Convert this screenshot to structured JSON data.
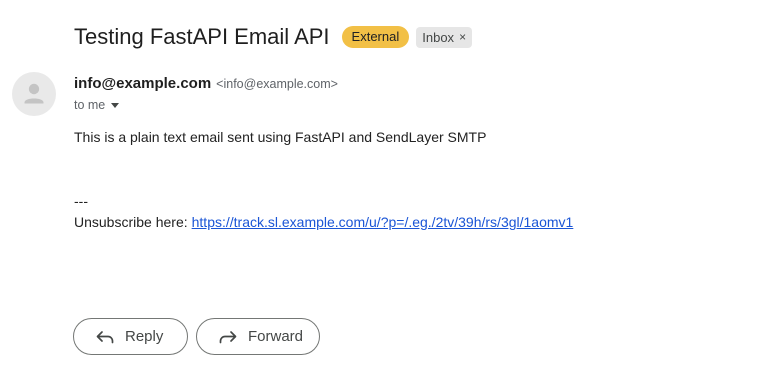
{
  "subject": "Testing FastAPI Email API",
  "labels": {
    "external": "External",
    "inbox": "Inbox",
    "inbox_remove": "×"
  },
  "sender": {
    "name": "info@example.com",
    "email": "<info@example.com>",
    "to": "to me"
  },
  "body": {
    "text": "This is a plain text email sent using FastAPI and SendLayer SMTP",
    "signature_dash": "---",
    "unsubscribe_prefix": "Unsubscribe here:",
    "unsubscribe_link": "https://track.sl.example.com/u/?p=/.eg./2tv/39h/rs/3gl/1aomv1"
  },
  "actions": {
    "reply": "Reply",
    "forward": "Forward"
  },
  "icons": {
    "avatar": "person-icon",
    "reply": "reply-arrow-icon",
    "forward": "forward-arrow-icon",
    "recipients": "chevron-down-icon"
  },
  "colors": {
    "external_badge": "#f2c046",
    "inbox_badge": "#e6e6e6",
    "link": "#1a55d6"
  }
}
